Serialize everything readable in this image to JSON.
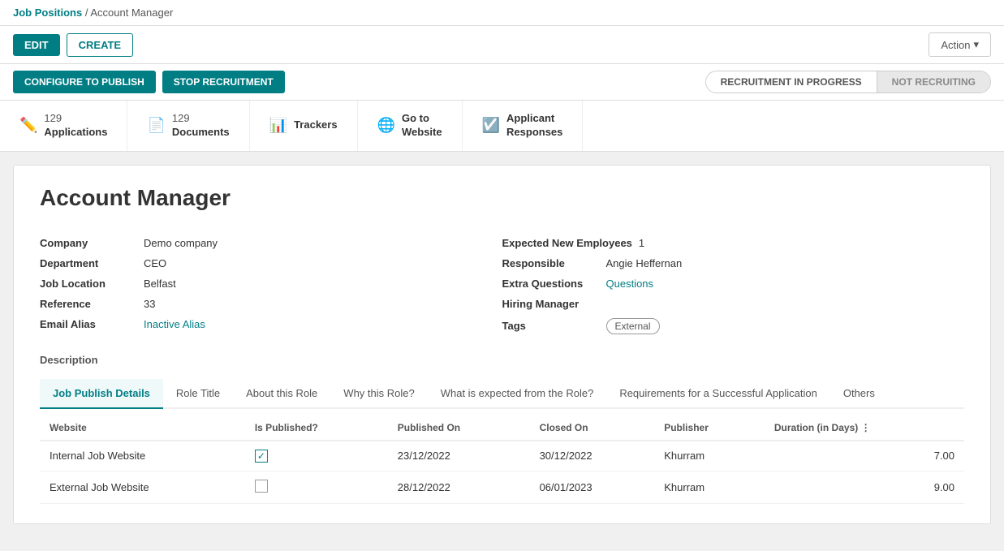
{
  "breadcrumb": {
    "parent": "Job Positions",
    "separator": "/",
    "current": "Account Manager"
  },
  "toolbar": {
    "edit_label": "EDIT",
    "create_label": "CREATE",
    "action_label": "Action"
  },
  "recruitment_bar": {
    "configure_label": "CONFIGURE TO PUBLISH",
    "stop_label": "STOP RECRUITMENT",
    "status_recruiting": "RECRUITMENT IN PROGRESS",
    "status_not_recruiting": "NOT RECRUITING"
  },
  "stats": [
    {
      "icon": "pencil",
      "count": "129",
      "label": "Applications"
    },
    {
      "icon": "doc",
      "count": "129",
      "label": "Documents"
    },
    {
      "icon": "bar-chart",
      "count": "",
      "label": "Trackers"
    },
    {
      "icon": "globe",
      "count": "",
      "label": "Go to\nWebsite"
    },
    {
      "icon": "check",
      "count": "",
      "label": "Applicant\nResponses"
    }
  ],
  "job": {
    "title": "Account Manager",
    "company": "Demo company",
    "department": "CEO",
    "job_location": "Belfast",
    "reference": "33",
    "email_alias": "Inactive Alias",
    "expected_new_employees": "1",
    "responsible": "Angie Heffernan",
    "extra_questions": "Questions",
    "hiring_manager": "Hiring Manager",
    "tags": "External"
  },
  "description_label": "Description",
  "tabs": [
    {
      "label": "Job Publish Details",
      "active": true
    },
    {
      "label": "Role Title",
      "active": false
    },
    {
      "label": "About this Role",
      "active": false
    },
    {
      "label": "Why this Role?",
      "active": false
    },
    {
      "label": "What is expected from the Role?",
      "active": false
    },
    {
      "label": "Requirements for a Successful Application",
      "active": false
    },
    {
      "label": "Others",
      "active": false
    }
  ],
  "table": {
    "columns": [
      "Website",
      "Is Published?",
      "Published On",
      "Closed On",
      "Publisher",
      "Duration (in Days)"
    ],
    "rows": [
      {
        "website": "Internal Job Website",
        "published": true,
        "published_on": "23/12/2022",
        "closed_on": "30/12/2022",
        "publisher": "Khurram",
        "duration": "7.00"
      },
      {
        "website": "External Job Website",
        "published": false,
        "published_on": "28/12/2022",
        "closed_on": "06/01/2023",
        "publisher": "Khurram",
        "duration": "9.00"
      }
    ]
  },
  "labels": {
    "company": "Company",
    "department": "Department",
    "job_location": "Job Location",
    "reference": "Reference",
    "email_alias": "Email Alias",
    "expected_new_employees": "Expected New Employees",
    "responsible": "Responsible",
    "extra_questions": "Extra Questions",
    "hiring_manager": "Hiring Manager",
    "tags": "Tags"
  }
}
